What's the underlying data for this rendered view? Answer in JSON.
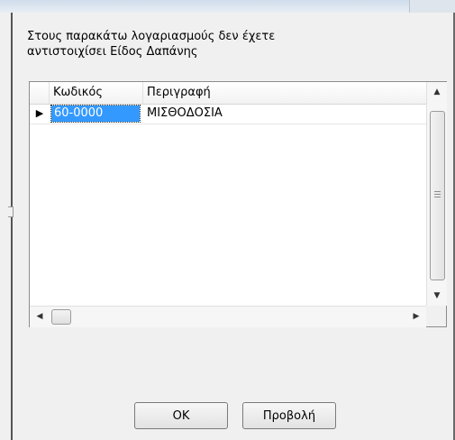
{
  "message": {
    "line1": "Στους παρακάτω λογαριασμούς δεν έχετε",
    "line2": "αντιστοιχίσει Είδος Δαπάνης"
  },
  "grid": {
    "columns": [
      "Κωδικός",
      "Περιγραφή"
    ],
    "rows": [
      {
        "code": "60-0000",
        "description": "ΜΙΣΘΟΔΟΣΙΑ",
        "selected": true
      }
    ]
  },
  "buttons": {
    "ok": "OK",
    "view": "Προβολή"
  },
  "icons": {
    "row_indicator": "arrow-right-icon",
    "scroll_up": "triangle-up-icon",
    "scroll_down": "triangle-down-icon",
    "scroll_left": "triangle-left-icon",
    "scroll_right": "triangle-right-icon"
  }
}
